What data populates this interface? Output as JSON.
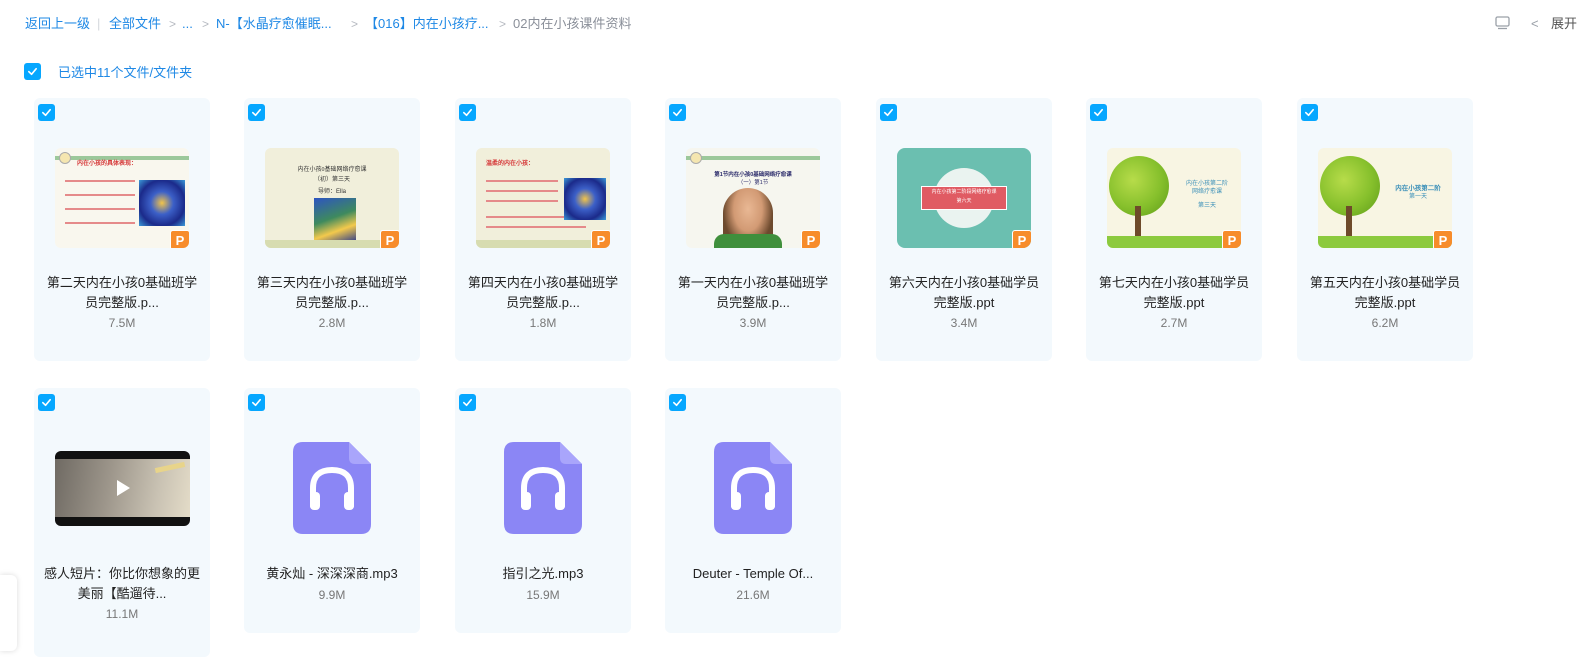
{
  "breadcrumb": {
    "back": "返回上一级",
    "all_files": "全部文件",
    "ellipsis": "...",
    "folder1": "N-【水晶疗愈催眠...",
    "folder2": "【016】内在小孩疗...",
    "current": "02内在小孩课件资料",
    "expand": "展开"
  },
  "selection": {
    "label": "已选中11个文件/文件夹"
  },
  "files": [
    {
      "name_line1": "第二天内在小孩0基础班学",
      "name_line2": "员完整版.p...",
      "size": "7.5M",
      "type": "ppt"
    },
    {
      "name_line1": "第三天内在小孩0基础班学",
      "name_line2": "员完整版.p...",
      "size": "2.8M",
      "type": "ppt"
    },
    {
      "name_line1": "第四天内在小孩0基础班学",
      "name_line2": "员完整版.p...",
      "size": "1.8M",
      "type": "ppt"
    },
    {
      "name_line1": "第一天内在小孩0基础班学",
      "name_line2": "员完整版.p...",
      "size": "3.9M",
      "type": "ppt"
    },
    {
      "name_line1": "第六天内在小孩0基础学员",
      "name_line2": "完整版.ppt",
      "size": "3.4M",
      "type": "ppt"
    },
    {
      "name_line1": "第七天内在小孩0基础学员",
      "name_line2": "完整版.ppt",
      "size": "2.7M",
      "type": "ppt"
    },
    {
      "name_line1": "第五天内在小孩0基础学员",
      "name_line2": "完整版.ppt",
      "size": "6.2M",
      "type": "ppt"
    },
    {
      "name_line1": "感人短片：你比你想象的更",
      "name_line2": "美丽【酷遛待...",
      "size": "11.1M",
      "type": "video"
    },
    {
      "name_line1": "黄永灿 - 深深深商.mp3",
      "name_line2": "",
      "size": "9.9M",
      "type": "audio"
    },
    {
      "name_line1": "指引之光.mp3",
      "name_line2": "",
      "size": "15.9M",
      "type": "audio"
    },
    {
      "name_line1": "Deuter - Temple Of...",
      "name_line2": "",
      "size": "21.6M",
      "type": "audio"
    }
  ],
  "thumb_text": {
    "t1_title": "内在小孩的具体表现：",
    "t2_line1": "内在小孩0基础网络疗愈课",
    "t2_line2": "（初）第三天",
    "t2_teacher": "导师：Ella",
    "t3_title": "温柔的内在小孩：",
    "t4_line1": "第1节内在小孩0基础网络疗愈课",
    "t4_line2": "（一）第1节",
    "t5_line1": "内在小孩第二阶段网络疗愈课",
    "t5_line2": "第六天",
    "t6_line1": "内在小孩第二阶",
    "t6_line2": "网络疗愈课",
    "t6_line3": "第三天",
    "t7_line1": "内在小孩第二阶",
    "t7_line2": "第一天"
  },
  "colors": {
    "accent": "#06a7ff",
    "link": "#1e88e5",
    "ppt": "#f78c2b",
    "audio": "#8b86f5",
    "card_bg": "#f3f9fd"
  }
}
